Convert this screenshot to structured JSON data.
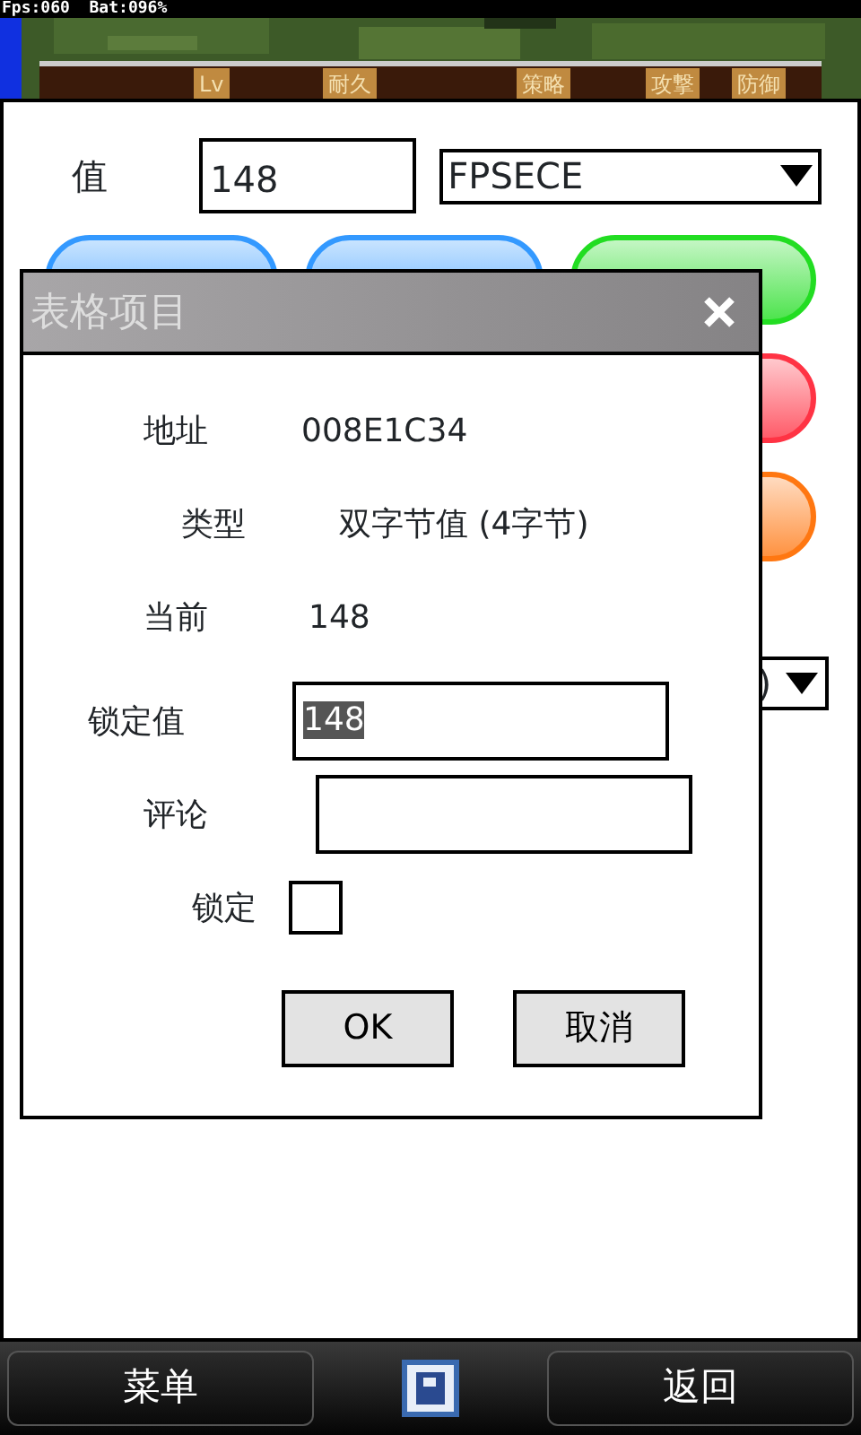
{
  "status_overlay": {
    "text": "Fps:060  Bat:096%"
  },
  "game_tabs": [
    {
      "label": "Lv"
    },
    {
      "label": "耐久"
    },
    {
      "label": "策略"
    },
    {
      "label": "攻撃"
    },
    {
      "label": "防御"
    }
  ],
  "search_row": {
    "label": "值",
    "value": "148",
    "select_value": "FPSECE"
  },
  "pill_buttons": [
    {
      "color": "#3399ff"
    },
    {
      "color": "#3399ff"
    },
    {
      "color": "#22dd22"
    },
    {
      "color": "#ff3344"
    },
    {
      "color": "#ff7711"
    }
  ],
  "hidden_select": {
    "value": ")"
  },
  "dialog": {
    "title": "表格项目",
    "rows": [
      {
        "kind": "info",
        "label": "地址",
        "value": "008E1C34"
      },
      {
        "kind": "info",
        "label": "类型",
        "value": "双字节值 (4字节)"
      },
      {
        "kind": "info",
        "label": "当前",
        "value": "148"
      },
      {
        "kind": "input",
        "label": "锁定值",
        "value": "148",
        "text_selected": true
      },
      {
        "kind": "input",
        "label": "评论"
      },
      {
        "kind": "checkbox",
        "label": "锁定",
        "checked": false
      }
    ],
    "buttons": [
      "OK",
      "取消"
    ]
  },
  "softkeys": {
    "left": "菜单",
    "right": "返回"
  }
}
